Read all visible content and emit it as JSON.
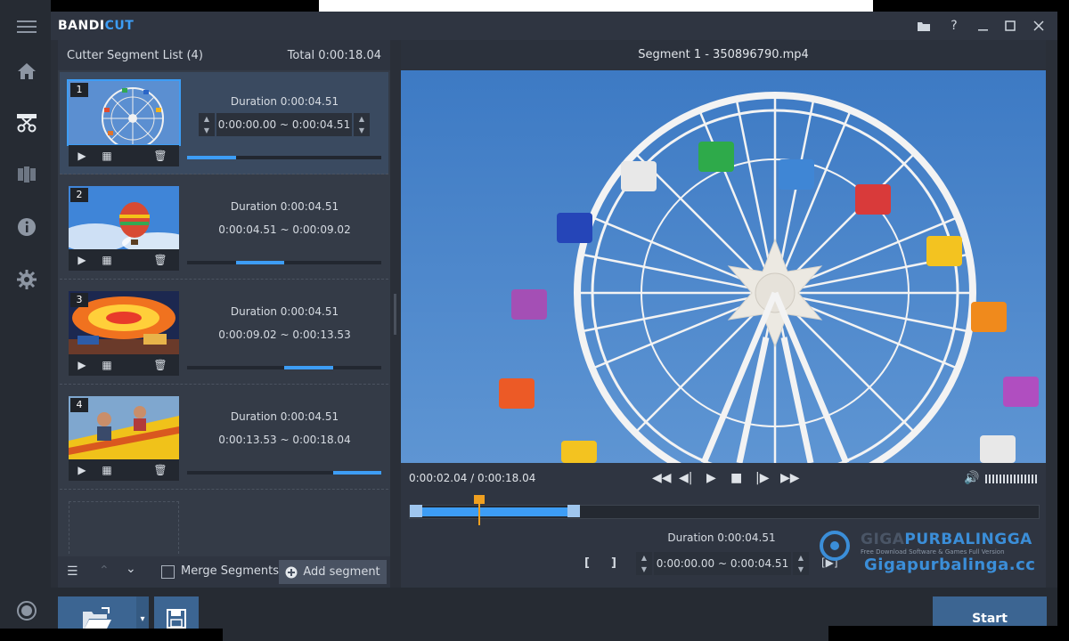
{
  "app": {
    "brand_a": "BANDI",
    "brand_b": "CUT"
  },
  "left_panel": {
    "title": "Cutter Segment List (4)",
    "total": "Total 0:00:18.04",
    "segments": [
      {
        "num": "1",
        "duration": "Duration 0:00:04.51",
        "start": "0:00:00.00",
        "sep": "~",
        "end": "0:00:04.51",
        "fill_start_pct": 0,
        "fill_end_pct": 25
      },
      {
        "num": "2",
        "duration": "Duration 0:00:04.51",
        "start": "0:00:04.51",
        "sep": "~",
        "end": "0:00:09.02",
        "fill_start_pct": 25,
        "fill_end_pct": 50
      },
      {
        "num": "3",
        "duration": "Duration 0:00:04.51",
        "start": "0:00:09.02",
        "sep": "~",
        "end": "0:00:13.53",
        "fill_start_pct": 50,
        "fill_end_pct": 75
      },
      {
        "num": "4",
        "duration": "Duration 0:00:04.51",
        "start": "0:00:13.53",
        "sep": "~",
        "end": "0:00:18.04",
        "fill_start_pct": 75,
        "fill_end_pct": 100
      }
    ],
    "merge_label": "Merge Segments",
    "add_segment_label": "Add segment"
  },
  "preview": {
    "title": "Segment 1 - 350896790.mp4",
    "time_current": "0:00:02.04",
    "time_sep": "/",
    "time_total": "0:00:18.04",
    "playhead_pct": 11,
    "selection_end_pct": 26,
    "duration": "Duration 0:00:04.51",
    "start": "0:00:00.00",
    "sep": "~",
    "end": "0:00:04.51",
    "mark_in": "[",
    "mark_out": "]"
  },
  "watermark": {
    "brand_a": "GIGA",
    "brand_b": "PURBALINGGA",
    "tagline": "Free Download Software & Games Full Version",
    "url": "Gigapurbalinga.cc"
  },
  "bottom": {
    "start_label": "Start"
  }
}
